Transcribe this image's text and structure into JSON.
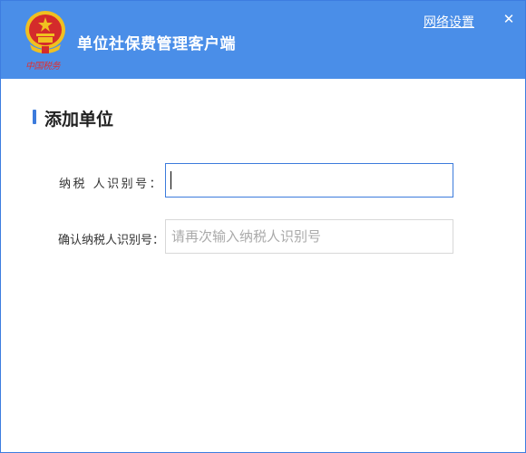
{
  "header": {
    "app_title": "单位社保费管理客户端",
    "emblem_caption": "中国税务",
    "network_settings": "网络设置",
    "close_symbol": "✕"
  },
  "section": {
    "title": "添加单位"
  },
  "form": {
    "taxpayer_id_label": "纳税 人识别号：",
    "taxpayer_id_value": "",
    "confirm_id_label": "确认纳税人识别号：",
    "confirm_id_placeholder": "请再次输入纳税人识别号",
    "confirm_id_value": ""
  },
  "colors": {
    "header_bg": "#4a8ee8",
    "accent": "#3c7bdc",
    "emblem_red": "#d42b2b",
    "emblem_gold": "#f0c020"
  }
}
